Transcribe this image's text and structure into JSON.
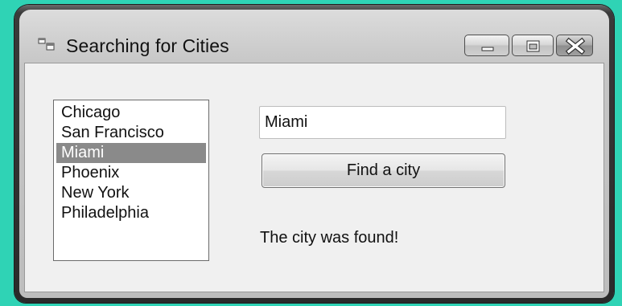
{
  "window": {
    "title": "Searching for Cities",
    "controls": {
      "minimize": "minimize",
      "maximize": "maximize",
      "close": "close"
    }
  },
  "list": {
    "items": [
      "Chicago",
      "San Francisco",
      "Miami",
      "Phoenix",
      "New York",
      "Philadelphia"
    ],
    "selected_index": 2
  },
  "search": {
    "value": "Miami"
  },
  "find_button": {
    "label": "Find a city"
  },
  "result": {
    "text": "The city was found!"
  },
  "colors": {
    "background": "#2fd3b5",
    "selection": "#8a8a8a"
  }
}
